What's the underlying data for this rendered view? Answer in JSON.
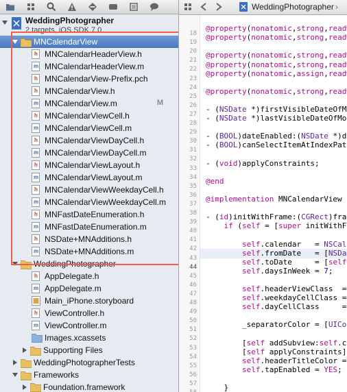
{
  "navigator": {
    "toolbar_icons": [
      "folder-icon",
      "symbol-icon",
      "search-icon",
      "warning-icon",
      "breakpoint-icon",
      "test-icon",
      "log-icon",
      "speech-icon"
    ],
    "project": {
      "name": "WeddingPhotographer",
      "subtitle": "2 targets, iOS SDK 7.0"
    },
    "rows": [
      {
        "label": "MNCalendarView",
        "type": "group",
        "indent": 1,
        "open": true,
        "selected": true
      },
      {
        "label": "MNCalendarHeaderView.h",
        "type": "h",
        "indent": 2
      },
      {
        "label": "MNCalendarHeaderView.m",
        "type": "m",
        "indent": 2
      },
      {
        "label": "MNCalendarView-Prefix.pch",
        "type": "h",
        "indent": 2
      },
      {
        "label": "MNCalendarView.h",
        "type": "h",
        "indent": 2
      },
      {
        "label": "MNCalendarView.m",
        "type": "m",
        "indent": 2,
        "badge": "M"
      },
      {
        "label": "MNCalendarViewCell.h",
        "type": "h",
        "indent": 2
      },
      {
        "label": "MNCalendarViewCell.m",
        "type": "m",
        "indent": 2
      },
      {
        "label": "MNCalendarViewDayCell.h",
        "type": "h",
        "indent": 2
      },
      {
        "label": "MNCalendarViewDayCell.m",
        "type": "m",
        "indent": 2
      },
      {
        "label": "MNCalendarViewLayout.h",
        "type": "h",
        "indent": 2
      },
      {
        "label": "MNCalendarViewLayout.m",
        "type": "m",
        "indent": 2
      },
      {
        "label": "MNCalendarViewWeekdayCell.h",
        "type": "h",
        "indent": 2
      },
      {
        "label": "MNCalendarViewWeekdayCell.m",
        "type": "m",
        "indent": 2
      },
      {
        "label": "MNFastDateEnumeration.h",
        "type": "h",
        "indent": 2
      },
      {
        "label": "MNFastDateEnumeration.m",
        "type": "m",
        "indent": 2
      },
      {
        "label": "NSDate+MNAdditions.h",
        "type": "h",
        "indent": 2
      },
      {
        "label": "NSDate+MNAdditions.m",
        "type": "m",
        "indent": 2
      },
      {
        "label": "WeddingPhotographer",
        "type": "group",
        "indent": 1,
        "open": true
      },
      {
        "label": "AppDelegate.h",
        "type": "h",
        "indent": 2
      },
      {
        "label": "AppDelegate.m",
        "type": "m",
        "indent": 2
      },
      {
        "label": "Main_iPhone.storyboard",
        "type": "storyboard",
        "indent": 2
      },
      {
        "label": "ViewController.h",
        "type": "h",
        "indent": 2
      },
      {
        "label": "ViewController.m",
        "type": "m",
        "indent": 2
      },
      {
        "label": "Images.xcassets",
        "type": "assets",
        "indent": 2
      },
      {
        "label": "Supporting Files",
        "type": "group",
        "indent": 2,
        "open": false
      },
      {
        "label": "WeddingPhotographerTests",
        "type": "group",
        "indent": 1,
        "open": false
      },
      {
        "label": "Frameworks",
        "type": "group",
        "indent": 1,
        "open": true
      },
      {
        "label": "Foundation.framework",
        "type": "framework",
        "indent": 2,
        "open": false
      }
    ]
  },
  "editor": {
    "jumpbar": {
      "file_label": "WeddingPhotographer"
    },
    "line_numbers": [
      "18",
      "19",
      "20",
      "21",
      "22",
      "23",
      "24",
      "25",
      "26",
      "27",
      "28",
      "29",
      "30",
      "31",
      "32",
      "33",
      "34",
      "35",
      "36",
      "37",
      "38",
      "39",
      "40",
      "41",
      "42",
      "43",
      "44",
      "45",
      "46",
      "47",
      "48",
      "49",
      "50",
      "51",
      "52",
      "53",
      "54",
      "55",
      "56",
      "57",
      "58",
      "59"
    ],
    "current_line": "44",
    "code_lines": [
      "",
      "@property(nonatomic,strong,readwri",
      "@property(nonatomic,strong,readwri",
      "",
      "@property(nonatomic,strong,readwri",
      "@property(nonatomic,strong,readwri",
      "@property(nonatomic,assign,readwri",
      "",
      "@property(nonatomic,strong,readwri",
      "",
      "- (NSDate *)firstVisibleDateOfMont",
      "- (NSDate *)lastVisibleDateOfMonth",
      "",
      "- (BOOL)dateEnabled:(NSDate *)date",
      "- (BOOL)canSelectItemAtIndexPath:(",
      "",
      "- (void)applyConstraints;",
      "",
      "@end",
      "",
      "@implementation MNCalendarView",
      "",
      "- (id)initWithFrame:(CGRect)frame",
      "    if (self = [super initWithFram",
      "",
      "        self.calendar   = NSCalenda",
      "        self.fromDate   = [NSDate.d",
      "        self.toDate     = [self.fro",
      "        self.daysInWeek = 7;",
      "",
      "        self.headerViewClass  = MNC",
      "        self.weekdayCellClass = MNC",
      "        self.dayCellClass     = MNC",
      "",
      "        _separatorColor = [UIColor",
      "",
      "        [self addSubview:self.colle",
      "        [self applyConstraints];",
      "        self.headerTitleColor = [UI",
      "        self.tapEnabled = YES;",
      "",
      "    }"
    ],
    "keyword_color": "#aa0d91",
    "class_color": "#5c2699",
    "number_color": "#1c00cf"
  },
  "colors": {
    "selection": "#4a78c0",
    "highlight_box": "#ee5e4c",
    "h_file": "#c0392b",
    "m_file": "#3b6ab4"
  }
}
